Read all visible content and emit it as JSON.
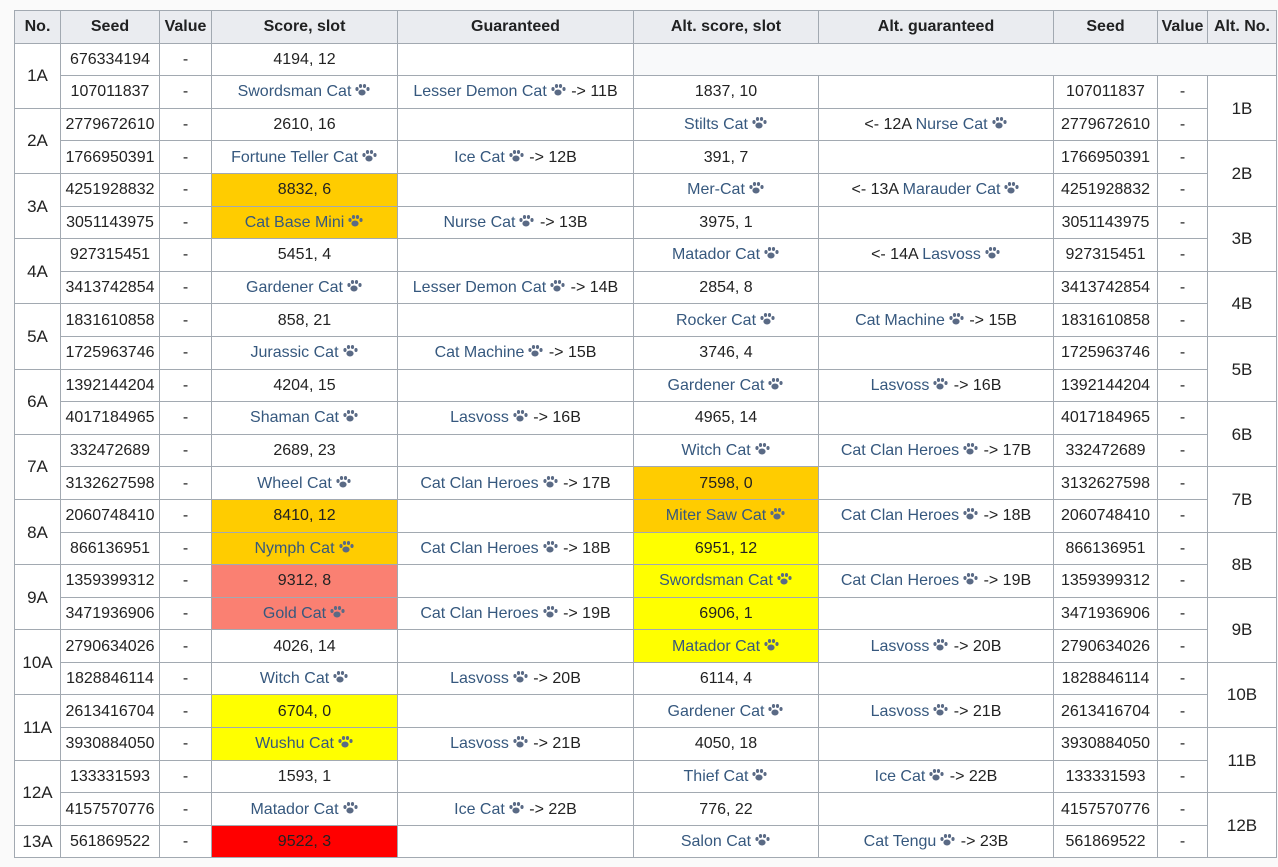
{
  "headers": [
    "No.",
    "Seed",
    "Value",
    "Score, slot",
    "Guaranteed",
    "Alt. score, slot",
    "Alt. guaranteed",
    "Seed",
    "Value",
    "Alt. No."
  ],
  "colors": {
    "orange": "#ffcc00",
    "yellow": "#ffff00",
    "salmon": "#fa8072",
    "red": "#ff0000",
    "link": "#36587e"
  },
  "paw_icon": "paw-print-icon",
  "groups": [
    {
      "label": "1A",
      "altno": null
    },
    {
      "label": "2A",
      "altno": "1B"
    },
    {
      "label": "3A",
      "altno": "2B"
    },
    {
      "label": "4A",
      "altno": "3B"
    },
    {
      "label": "5A",
      "altno": "4B"
    },
    {
      "label": "6A",
      "altno": "5B"
    },
    {
      "label": "7A",
      "altno": "6B"
    },
    {
      "label": "8A",
      "altno": "7B"
    },
    {
      "label": "9A",
      "altno": "8B"
    },
    {
      "label": "10A",
      "altno": "9B"
    },
    {
      "label": "11A",
      "altno": "10B"
    },
    {
      "label": "12A",
      "altno": "11B"
    },
    {
      "label": "13A",
      "altno": "12B"
    }
  ],
  "rows": [
    {
      "seed": "676334194",
      "value": "-",
      "score": {
        "text": "4194, 12",
        "link": false,
        "color": ""
      },
      "guar": null,
      "alt": null
    },
    {
      "seed": "107011837",
      "value": "-",
      "score": {
        "text": "Swordsman Cat",
        "link": true,
        "color": ""
      },
      "guar": {
        "name": "Lesser Demon Cat",
        "suffix": "-> 11B"
      },
      "alt": {
        "score": {
          "text": "1837, 10",
          "link": false,
          "color": ""
        },
        "guar": null,
        "seed": "107011837",
        "value": "-"
      }
    },
    {
      "seed": "2779672610",
      "value": "-",
      "score": {
        "text": "2610, 16",
        "link": false,
        "color": ""
      },
      "guar": null,
      "alt": {
        "score": {
          "text": "Stilts Cat",
          "link": true,
          "color": ""
        },
        "guar": {
          "prefix": "<- 12A",
          "name": "Nurse Cat",
          "suffix": ""
        },
        "seed": "2779672610",
        "value": "-"
      }
    },
    {
      "seed": "1766950391",
      "value": "-",
      "score": {
        "text": "Fortune Teller Cat",
        "link": true,
        "color": ""
      },
      "guar": {
        "name": "Ice Cat",
        "suffix": "-> 12B"
      },
      "alt": {
        "score": {
          "text": "391, 7",
          "link": false,
          "color": ""
        },
        "guar": null,
        "seed": "1766950391",
        "value": "-"
      }
    },
    {
      "seed": "4251928832",
      "value": "-",
      "score": {
        "text": "8832, 6",
        "link": false,
        "color": "orange"
      },
      "guar": null,
      "alt": {
        "score": {
          "text": "Mer-Cat",
          "link": true,
          "color": ""
        },
        "guar": {
          "prefix": "<- 13A",
          "name": "Marauder Cat",
          "suffix": ""
        },
        "seed": "4251928832",
        "value": "-"
      }
    },
    {
      "seed": "3051143975",
      "value": "-",
      "score": {
        "text": "Cat Base Mini",
        "link": true,
        "color": "orange"
      },
      "guar": {
        "name": "Nurse Cat",
        "suffix": "-> 13B"
      },
      "alt": {
        "score": {
          "text": "3975, 1",
          "link": false,
          "color": ""
        },
        "guar": null,
        "seed": "3051143975",
        "value": "-"
      }
    },
    {
      "seed": "927315451",
      "value": "-",
      "score": {
        "text": "5451, 4",
        "link": false,
        "color": ""
      },
      "guar": null,
      "alt": {
        "score": {
          "text": "Matador Cat",
          "link": true,
          "color": ""
        },
        "guar": {
          "prefix": "<- 14A",
          "name": "Lasvoss",
          "suffix": ""
        },
        "seed": "927315451",
        "value": "-"
      }
    },
    {
      "seed": "3413742854",
      "value": "-",
      "score": {
        "text": "Gardener Cat",
        "link": true,
        "color": ""
      },
      "guar": {
        "name": "Lesser Demon Cat",
        "suffix": "-> 14B"
      },
      "alt": {
        "score": {
          "text": "2854, 8",
          "link": false,
          "color": ""
        },
        "guar": null,
        "seed": "3413742854",
        "value": "-"
      }
    },
    {
      "seed": "1831610858",
      "value": "-",
      "score": {
        "text": "858, 21",
        "link": false,
        "color": ""
      },
      "guar": null,
      "alt": {
        "score": {
          "text": "Rocker Cat",
          "link": true,
          "color": ""
        },
        "guar": {
          "prefix": "",
          "name": "Cat Machine",
          "suffix": "-> 15B"
        },
        "seed": "1831610858",
        "value": "-"
      }
    },
    {
      "seed": "1725963746",
      "value": "-",
      "score": {
        "text": "Jurassic Cat",
        "link": true,
        "color": ""
      },
      "guar": {
        "name": "Cat Machine",
        "suffix": "-> 15B"
      },
      "alt": {
        "score": {
          "text": "3746, 4",
          "link": false,
          "color": ""
        },
        "guar": null,
        "seed": "1725963746",
        "value": "-"
      }
    },
    {
      "seed": "1392144204",
      "value": "-",
      "score": {
        "text": "4204, 15",
        "link": false,
        "color": ""
      },
      "guar": null,
      "alt": {
        "score": {
          "text": "Gardener Cat",
          "link": true,
          "color": ""
        },
        "guar": {
          "prefix": "",
          "name": "Lasvoss",
          "suffix": "-> 16B"
        },
        "seed": "1392144204",
        "value": "-"
      }
    },
    {
      "seed": "4017184965",
      "value": "-",
      "score": {
        "text": "Shaman Cat",
        "link": true,
        "color": ""
      },
      "guar": {
        "name": "Lasvoss",
        "suffix": "-> 16B"
      },
      "alt": {
        "score": {
          "text": "4965, 14",
          "link": false,
          "color": ""
        },
        "guar": null,
        "seed": "4017184965",
        "value": "-"
      }
    },
    {
      "seed": "332472689",
      "value": "-",
      "score": {
        "text": "2689, 23",
        "link": false,
        "color": ""
      },
      "guar": null,
      "alt": {
        "score": {
          "text": "Witch Cat",
          "link": true,
          "color": ""
        },
        "guar": {
          "prefix": "",
          "name": "Cat Clan Heroes",
          "suffix": "-> 17B"
        },
        "seed": "332472689",
        "value": "-"
      }
    },
    {
      "seed": "3132627598",
      "value": "-",
      "score": {
        "text": "Wheel Cat",
        "link": true,
        "color": ""
      },
      "guar": {
        "name": "Cat Clan Heroes",
        "suffix": "-> 17B"
      },
      "alt": {
        "score": {
          "text": "7598, 0",
          "link": false,
          "color": "orange"
        },
        "guar": null,
        "seed": "3132627598",
        "value": "-"
      }
    },
    {
      "seed": "2060748410",
      "value": "-",
      "score": {
        "text": "8410, 12",
        "link": false,
        "color": "orange"
      },
      "guar": null,
      "alt": {
        "score": {
          "text": "Miter Saw Cat",
          "link": true,
          "color": "orange"
        },
        "guar": {
          "prefix": "",
          "name": "Cat Clan Heroes",
          "suffix": "-> 18B"
        },
        "seed": "2060748410",
        "value": "-"
      }
    },
    {
      "seed": "866136951",
      "value": "-",
      "score": {
        "text": "Nymph Cat",
        "link": true,
        "color": "orange"
      },
      "guar": {
        "name": "Cat Clan Heroes",
        "suffix": "-> 18B"
      },
      "alt": {
        "score": {
          "text": "6951, 12",
          "link": false,
          "color": "yellow"
        },
        "guar": null,
        "seed": "866136951",
        "value": "-"
      }
    },
    {
      "seed": "1359399312",
      "value": "-",
      "score": {
        "text": "9312, 8",
        "link": false,
        "color": "salmon"
      },
      "guar": null,
      "alt": {
        "score": {
          "text": "Swordsman Cat",
          "link": true,
          "color": "yellow"
        },
        "guar": {
          "prefix": "",
          "name": "Cat Clan Heroes",
          "suffix": "-> 19B"
        },
        "seed": "1359399312",
        "value": "-"
      }
    },
    {
      "seed": "3471936906",
      "value": "-",
      "score": {
        "text": "Gold Cat",
        "link": true,
        "color": "salmon"
      },
      "guar": {
        "name": "Cat Clan Heroes",
        "suffix": "-> 19B"
      },
      "alt": {
        "score": {
          "text": "6906, 1",
          "link": false,
          "color": "yellow"
        },
        "guar": null,
        "seed": "3471936906",
        "value": "-"
      }
    },
    {
      "seed": "2790634026",
      "value": "-",
      "score": {
        "text": "4026, 14",
        "link": false,
        "color": ""
      },
      "guar": null,
      "alt": {
        "score": {
          "text": "Matador Cat",
          "link": true,
          "color": "yellow"
        },
        "guar": {
          "prefix": "",
          "name": "Lasvoss",
          "suffix": "-> 20B"
        },
        "seed": "2790634026",
        "value": "-"
      }
    },
    {
      "seed": "1828846114",
      "value": "-",
      "score": {
        "text": "Witch Cat",
        "link": true,
        "color": ""
      },
      "guar": {
        "name": "Lasvoss",
        "suffix": "-> 20B"
      },
      "alt": {
        "score": {
          "text": "6114, 4",
          "link": false,
          "color": ""
        },
        "guar": null,
        "seed": "1828846114",
        "value": "-"
      }
    },
    {
      "seed": "2613416704",
      "value": "-",
      "score": {
        "text": "6704, 0",
        "link": false,
        "color": "yellow"
      },
      "guar": null,
      "alt": {
        "score": {
          "text": "Gardener Cat",
          "link": true,
          "color": ""
        },
        "guar": {
          "prefix": "",
          "name": "Lasvoss",
          "suffix": "-> 21B"
        },
        "seed": "2613416704",
        "value": "-"
      }
    },
    {
      "seed": "3930884050",
      "value": "-",
      "score": {
        "text": "Wushu Cat",
        "link": true,
        "color": "yellow"
      },
      "guar": {
        "name": "Lasvoss",
        "suffix": "-> 21B"
      },
      "alt": {
        "score": {
          "text": "4050, 18",
          "link": false,
          "color": ""
        },
        "guar": null,
        "seed": "3930884050",
        "value": "-"
      }
    },
    {
      "seed": "133331593",
      "value": "-",
      "score": {
        "text": "1593, 1",
        "link": false,
        "color": ""
      },
      "guar": null,
      "alt": {
        "score": {
          "text": "Thief Cat",
          "link": true,
          "color": ""
        },
        "guar": {
          "prefix": "",
          "name": "Ice Cat",
          "suffix": "-> 22B"
        },
        "seed": "133331593",
        "value": "-"
      }
    },
    {
      "seed": "4157570776",
      "value": "-",
      "score": {
        "text": "Matador Cat",
        "link": true,
        "color": ""
      },
      "guar": {
        "name": "Ice Cat",
        "suffix": "-> 22B"
      },
      "alt": {
        "score": {
          "text": "776, 22",
          "link": false,
          "color": ""
        },
        "guar": null,
        "seed": "4157570776",
        "value": "-"
      }
    },
    {
      "seed": "561869522",
      "value": "-",
      "score": {
        "text": "9522, 3",
        "link": false,
        "color": "red"
      },
      "guar": null,
      "alt": {
        "score": {
          "text": "Salon Cat",
          "link": true,
          "color": ""
        },
        "guar": {
          "prefix": "",
          "name": "Cat Tengu",
          "suffix": "-> 23B"
        },
        "seed": "561869522",
        "value": "-"
      }
    }
  ]
}
